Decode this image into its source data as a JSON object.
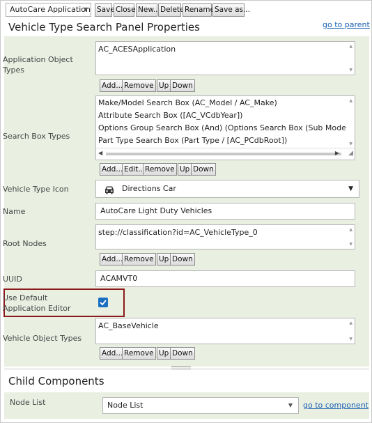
{
  "toolbar": {
    "app_select": "AutoCare Application",
    "buttons": [
      "Save",
      "Close",
      "New...",
      "Delete",
      "Rename",
      "Save as..."
    ]
  },
  "panel": {
    "title": "Vehicle Type Search Panel Properties",
    "go_to_parent": "go to parent"
  },
  "fields": {
    "app_object_types": {
      "label": "Application Object Types",
      "values": [
        "AC_ACESApplication"
      ],
      "buttons": [
        "Add...",
        "Remove",
        "Up",
        "Down"
      ]
    },
    "search_box_types": {
      "label": "Search Box Types",
      "values": [
        "Make/Model Search Box (AC_Model / AC_Make)",
        "Attribute Search Box ([AC_VCdbYear])",
        "Options Group Search Box (And) (Options Search Box (Sub Model) & Op",
        "Part Type Search Box (Part Type / [AC_PCdbRoot])"
      ],
      "buttons": [
        "Add...",
        "Edit...",
        "Remove",
        "Up",
        "Down"
      ]
    },
    "vehicle_type_icon": {
      "label": "Vehicle Type Icon",
      "value": "Directions Car"
    },
    "name": {
      "label": "Name",
      "value": "AutoCare Light Duty Vehicles"
    },
    "root_nodes": {
      "label": "Root Nodes",
      "values": [
        "step://classification?id=AC_VehicleType_0"
      ],
      "buttons": [
        "Add...",
        "Remove",
        "Up",
        "Down"
      ]
    },
    "uuid": {
      "label": "UUID",
      "value": "ACAMVT0"
    },
    "use_default_editor": {
      "label": "Use Default Application Editor",
      "checked": true
    },
    "vehicle_object_types": {
      "label": "Vehicle Object Types",
      "values": [
        "AC_BaseVehicle"
      ],
      "buttons": [
        "Add...",
        "Remove",
        "Up",
        "Down"
      ]
    }
  },
  "child": {
    "title": "Child Components",
    "node_list_label": "Node List",
    "node_list_value": "Node List",
    "go_to_component": "go to component"
  },
  "colors": {
    "panel_bg": "#e9f0e2",
    "link": "#1a5fb4",
    "highlight": "#8b1a1a",
    "checkbox": "#1b6fc1"
  }
}
